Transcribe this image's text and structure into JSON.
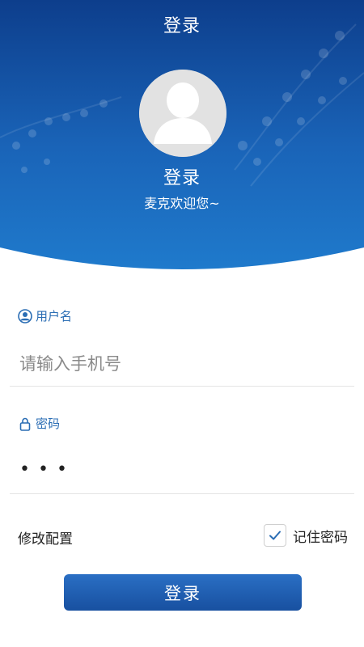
{
  "header": {
    "nav_title": "登录",
    "title": "登录",
    "subtitle": "麦克欢迎您~"
  },
  "form": {
    "username": {
      "label": "用户名",
      "icon": "user-circle-icon",
      "placeholder": "请输入手机号",
      "value": ""
    },
    "password": {
      "label": "密码",
      "icon": "lock-icon",
      "value": "•••"
    }
  },
  "options": {
    "modify_config": "修改配置",
    "remember_password": "记住密码",
    "remember_checked": true
  },
  "submit": {
    "label": "登录"
  },
  "colors": {
    "brand_blue": "#1a56a8",
    "label_blue": "#2a6db4"
  }
}
